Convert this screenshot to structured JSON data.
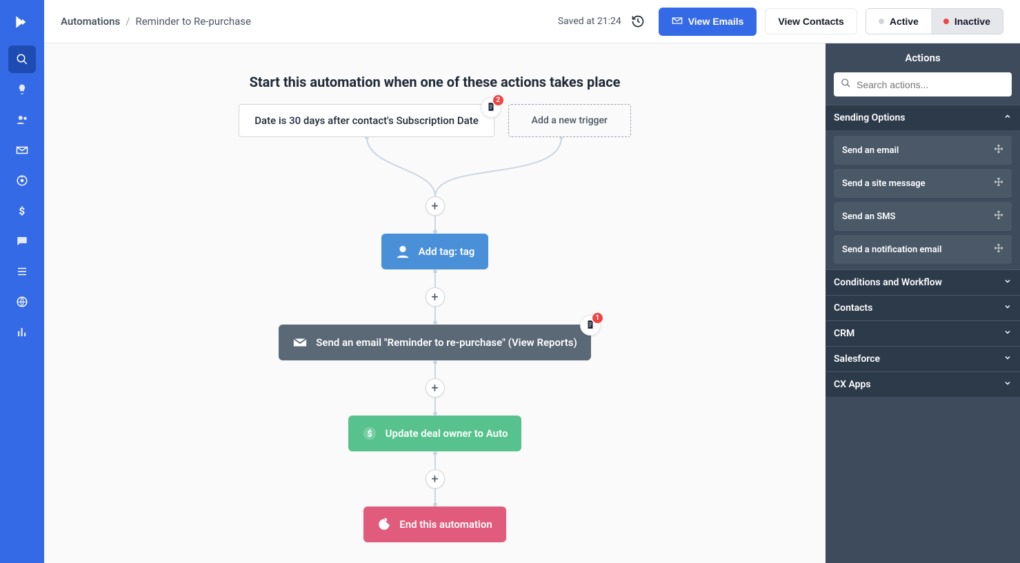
{
  "header": {
    "breadcrumb_root": "Automations",
    "breadcrumb_current": "Reminder to Re-purchase",
    "saved_at": "Saved at 21:24",
    "view_emails": "View Emails",
    "view_contacts": "View Contacts",
    "status_active": "Active",
    "status_inactive": "Inactive"
  },
  "canvas": {
    "title": "Start this automation when one of these actions takes place",
    "trigger1": "Date is 30 days after contact's Subscription Date",
    "trigger1_badge": "2",
    "add_trigger": "Add a new trigger",
    "node_tag": "Add tag: tag",
    "node_email": "Send an email \"Reminder to re-purchase\" (View Reports)",
    "node_email_badge": "1",
    "node_deal": "Update deal owner to Auto",
    "node_end": "End this automation"
  },
  "right": {
    "title": "Actions",
    "search_placeholder": "Search actions...",
    "sections": {
      "sending": "Sending Options",
      "conditions": "Conditions and Workflow",
      "contacts": "Contacts",
      "crm": "CRM",
      "salesforce": "Salesforce",
      "cxapps": "CX Apps"
    },
    "sending_items": {
      "0": "Send an email",
      "1": "Send a site message",
      "2": "Send an SMS",
      "3": "Send a notification email"
    }
  },
  "colors": {
    "primary": "#356ae6",
    "node_blue": "#4a90d9",
    "node_dark": "#5b6876",
    "node_green": "#57c28d",
    "node_pink": "#e05b7c",
    "panel_bg": "#3d4b5c"
  }
}
